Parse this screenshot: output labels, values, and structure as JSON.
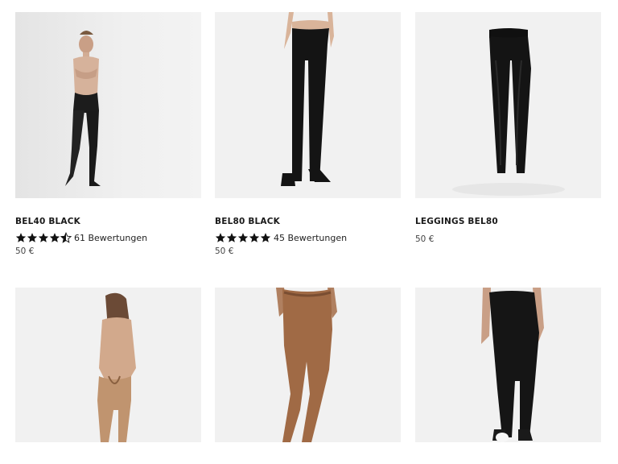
{
  "products": [
    {
      "title": "BEL40 BLACK",
      "rating_value": 4.5,
      "rating_text": "61 Bewertungen",
      "price": "50 €"
    },
    {
      "title": "BEL80 BLACK",
      "rating_value": 5,
      "rating_text": "45 Bewertungen",
      "price": "50 €"
    },
    {
      "title": "LEGGINGS BEL80",
      "price": "50 €"
    },
    {},
    {},
    {}
  ],
  "colors": {
    "star": "#111111",
    "image_bg": "#eeeeee",
    "tights_black": "#141414",
    "skin": "#d9b49a",
    "nude_tights": "#a06a45"
  },
  "icons": [
    "star-full-icon",
    "star-half-icon"
  ]
}
